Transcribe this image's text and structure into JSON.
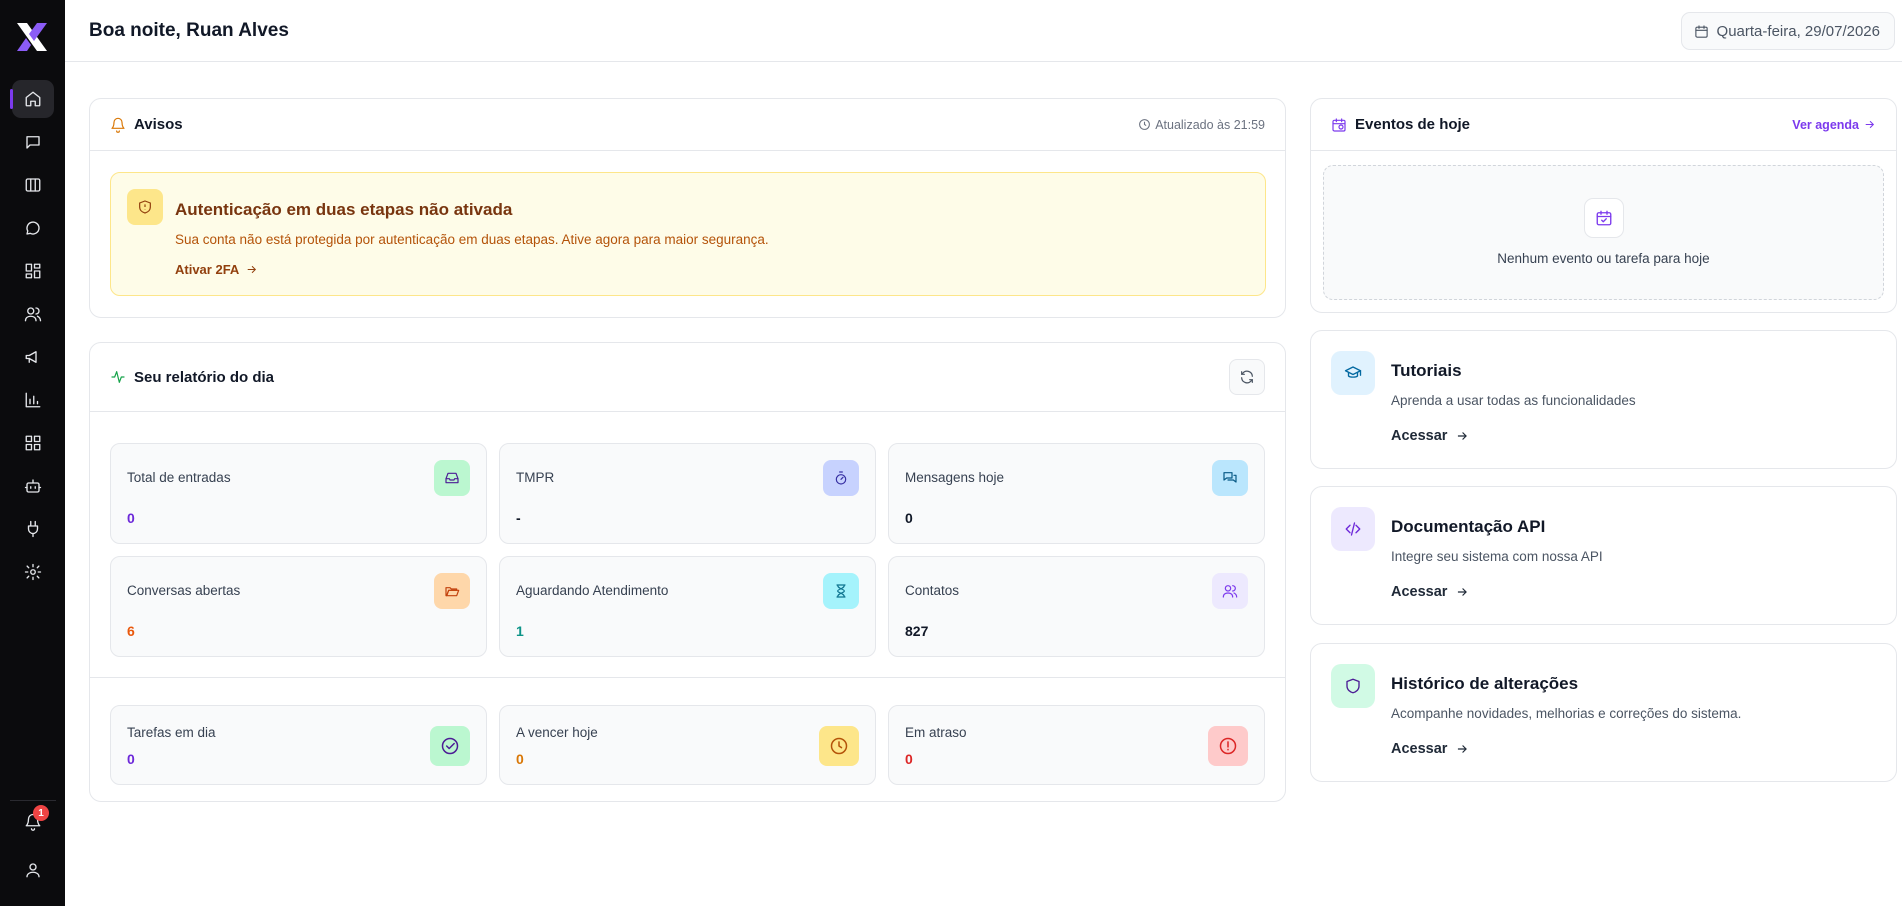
{
  "header": {
    "greeting": "Boa noite, Ruan Alves",
    "date": "Quarta-feira, 29/07/2026"
  },
  "sidebar": {
    "items": [
      {
        "icon": "home-icon"
      },
      {
        "icon": "message-square-icon"
      },
      {
        "icon": "kanban-icon"
      },
      {
        "icon": "message-circle-icon"
      },
      {
        "icon": "dashboard-icon"
      },
      {
        "icon": "users-icon"
      },
      {
        "icon": "megaphone-icon"
      },
      {
        "icon": "bar-chart-icon"
      },
      {
        "icon": "grid-icon"
      },
      {
        "icon": "bot-icon"
      },
      {
        "icon": "plug-icon"
      },
      {
        "icon": "gear-icon"
      }
    ],
    "notifications_count": "1"
  },
  "avisos": {
    "title": "Avisos",
    "updated": "Atualizado às 21:59",
    "alert": {
      "title": "Autenticação em duas etapas não ativada",
      "text": "Sua conta não está protegida por autenticação em duas etapas. Ative agora para maior segurança.",
      "link": "Ativar 2FA"
    }
  },
  "report": {
    "title": "Seu relatório do dia",
    "stats": [
      {
        "label": "Total de entradas",
        "value": "0",
        "color": "#6d28d9",
        "icon": "inbox-icon"
      },
      {
        "label": "TMPR",
        "value": "-",
        "color": "#111827",
        "icon": "timer-icon"
      },
      {
        "label": "Mensagens hoje",
        "value": "0",
        "color": "#111827",
        "icon": "messages-icon"
      },
      {
        "label": "Conversas abertas",
        "value": "6",
        "color": "#ea580c",
        "icon": "folder-open-icon"
      },
      {
        "label": "Aguardando Atendimento",
        "value": "1",
        "color": "#0d9488",
        "icon": "hourglass-icon"
      },
      {
        "label": "Contatos",
        "value": "827",
        "color": "#111827",
        "icon": "contacts-icon"
      }
    ],
    "tasks": [
      {
        "label": "Tarefas em dia",
        "value": "0",
        "color": "#6d28d9",
        "icon": "check-circle-icon"
      },
      {
        "label": "A vencer hoje",
        "value": "0",
        "color": "#d97706",
        "icon": "clock-icon"
      },
      {
        "label": "Em atraso",
        "value": "0",
        "color": "#dc2626",
        "icon": "alert-circle-icon"
      }
    ]
  },
  "events": {
    "title": "Eventos de hoje",
    "link": "Ver agenda",
    "empty": "Nenhum evento ou tarefa para hoje"
  },
  "resources": [
    {
      "title": "Tutoriais",
      "desc": "Aprenda a usar todas as funcionalidades",
      "action": "Acessar",
      "icon": "graduation-cap-icon"
    },
    {
      "title": "Documentação API",
      "desc": "Integre seu sistema com nossa API",
      "action": "Acessar",
      "icon": "code-icon"
    },
    {
      "title": "Histórico de alterações",
      "desc": "Acompanhe novidades, melhorias e correções do sistema.",
      "action": "Acessar",
      "icon": "shield-icon"
    }
  ]
}
